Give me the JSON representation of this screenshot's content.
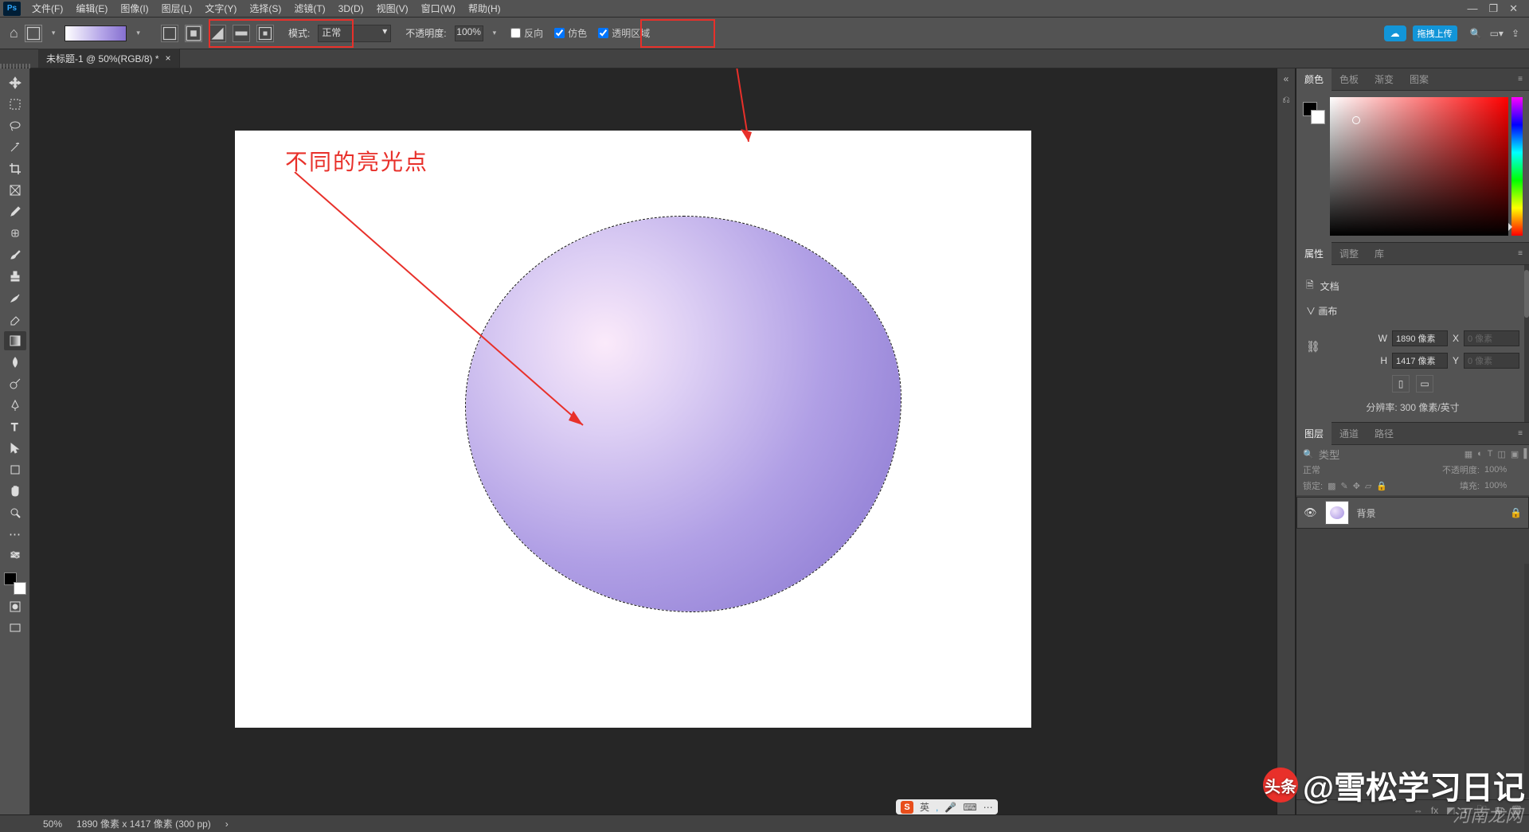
{
  "menu": {
    "items": [
      "文件(F)",
      "编辑(E)",
      "图像(I)",
      "图层(L)",
      "文字(Y)",
      "选择(S)",
      "滤镜(T)",
      "3D(D)",
      "视图(V)",
      "窗口(W)",
      "帮助(H)"
    ]
  },
  "win": {
    "min": "—",
    "restore": "❐",
    "close": "✕"
  },
  "optbar": {
    "mode_label": "模式:",
    "mode": "正常",
    "opacity_label": "不透明度:",
    "opacity": "100%",
    "reverse": "反向",
    "dither": "仿色",
    "transparency": "透明区域",
    "upload": "拖拽上传"
  },
  "tab": {
    "title": "未标题-1 @ 50%(RGB/8) *",
    "close": "×"
  },
  "annotation": {
    "text": "不同的亮光点"
  },
  "right": {
    "color_tabs": [
      "颜色",
      "色板",
      "渐变",
      "图案"
    ],
    "prop_tabs": [
      "属性",
      "调整",
      "库"
    ],
    "prop": {
      "doc": "文档",
      "canvas": "画布",
      "w_label": "W",
      "w": "1890 像素",
      "x_label": "X",
      "x": "0 像素",
      "h_label": "H",
      "h": "1417 像素",
      "y_label": "Y",
      "y": "0 像素",
      "res": "分辨率: 300 像素/英寸"
    },
    "layer_tabs": [
      "图层",
      "通道",
      "路径"
    ],
    "layer": {
      "filter": "类型",
      "blend": "正常",
      "opacity_label": "不透明度:",
      "opacity": "100%",
      "lock_label": "锁定:",
      "fill_label": "填充:",
      "fill": "100%",
      "bg": "背景"
    }
  },
  "status": {
    "zoom": "50%",
    "dims": "1890 像素 x 1417 像素 (300 pp)",
    "chev": "›"
  },
  "tray": {
    "ime": "英",
    "pin": "📌",
    "mic": "🎤",
    "kb": "⌨",
    "more": "⋯"
  },
  "watermark": {
    "text": "@雪松学习日记",
    "toutiao": "头条",
    "site": "河南龙网"
  }
}
